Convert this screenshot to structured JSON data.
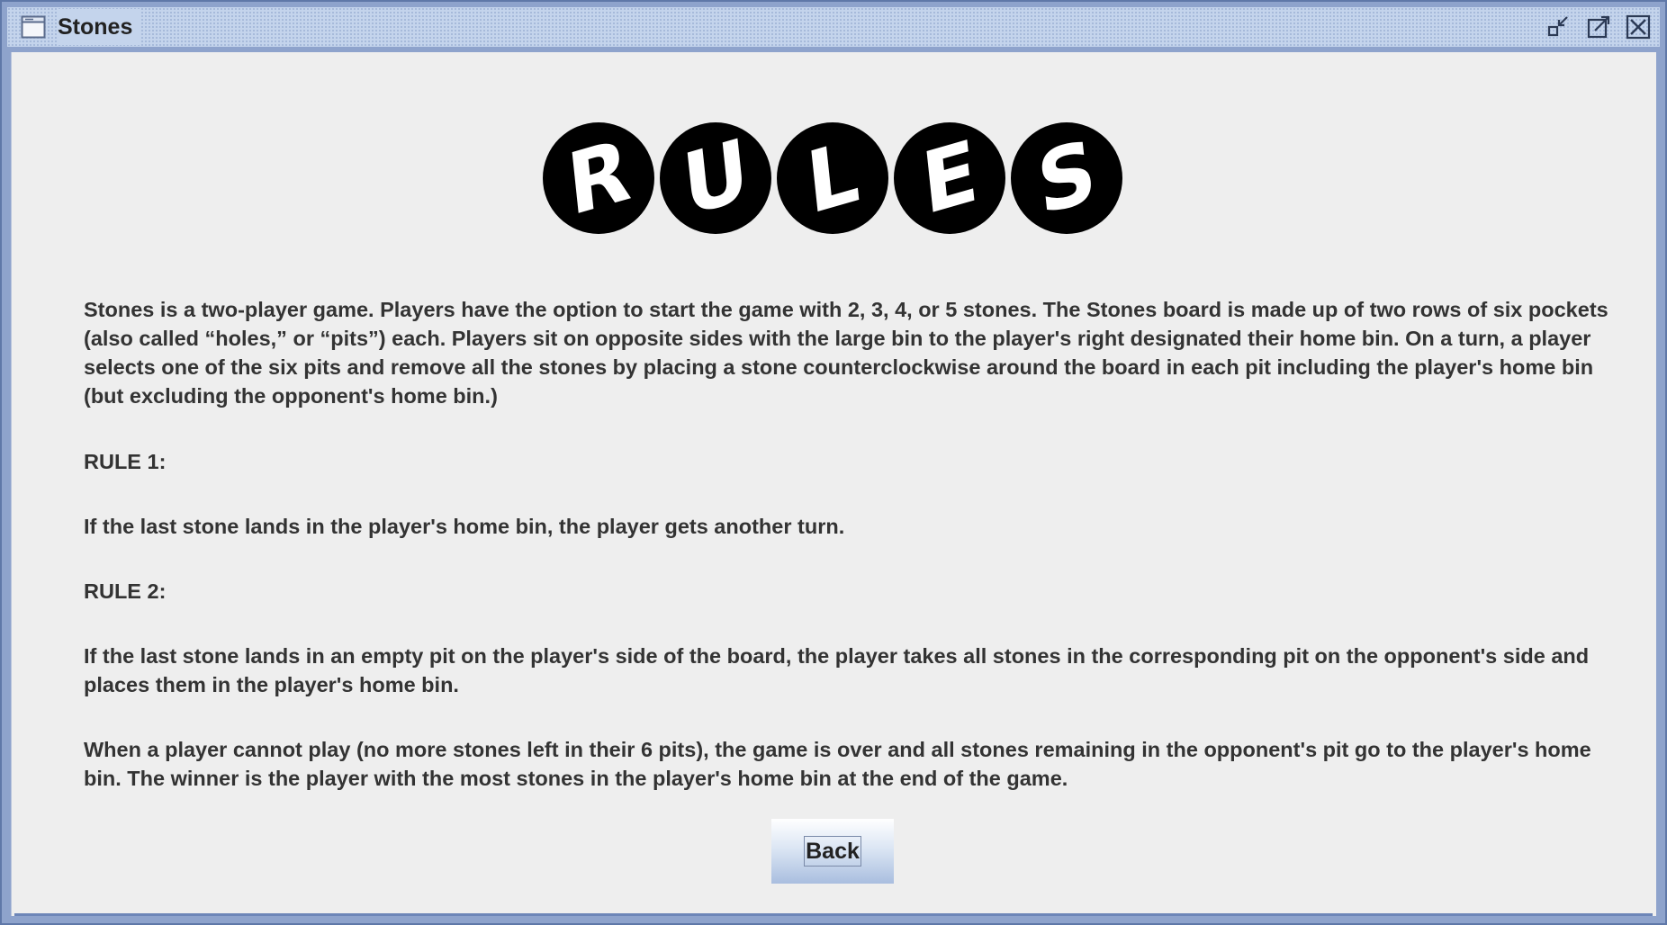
{
  "window": {
    "title": "Stones",
    "icons": [
      "window-app-icon",
      "minimize-icon",
      "maximize-icon",
      "close-icon"
    ]
  },
  "logo": {
    "letters": [
      "R",
      "U",
      "L",
      "E",
      "S"
    ]
  },
  "rules": {
    "intro": "Stones is a two-player game. Players have the option to start the game with 2, 3, 4, or 5 stones. The Stones board is made up of two rows of six pockets (also called “holes,” or “pits”) each. Players sit on opposite sides with the large bin to the player's right designated their home bin. On a turn, a player selects one of the six pits and remove all the stones by placing a stone counterclockwise around the board in each pit including the player's home bin (but excluding the opponent's home bin.)",
    "rule1_heading": "RULE 1:",
    "rule1_text": "If the last stone lands in the player's home bin, the player gets another turn.",
    "rule2_heading": "RULE 2:",
    "rule2_text": "If the last stone lands in an empty pit on the player's side of the board, the player takes all stones in the corresponding pit on the opponent's side and places them in the player's home bin.",
    "end_text": "When a player cannot play (no more stones left in their 6 pits), the game is over and all stones remaining in the opponent's pit go to the player's home bin. The winner is the player with the most stones in the player's home bin at the end of the game."
  },
  "buttons": {
    "back_label": "Back"
  },
  "colors": {
    "title_bar": "#c4d4ec",
    "window_border": "#8ea3cc",
    "content_bg": "#eeeeee",
    "text": "#333333",
    "logo_ball": "#000000"
  }
}
